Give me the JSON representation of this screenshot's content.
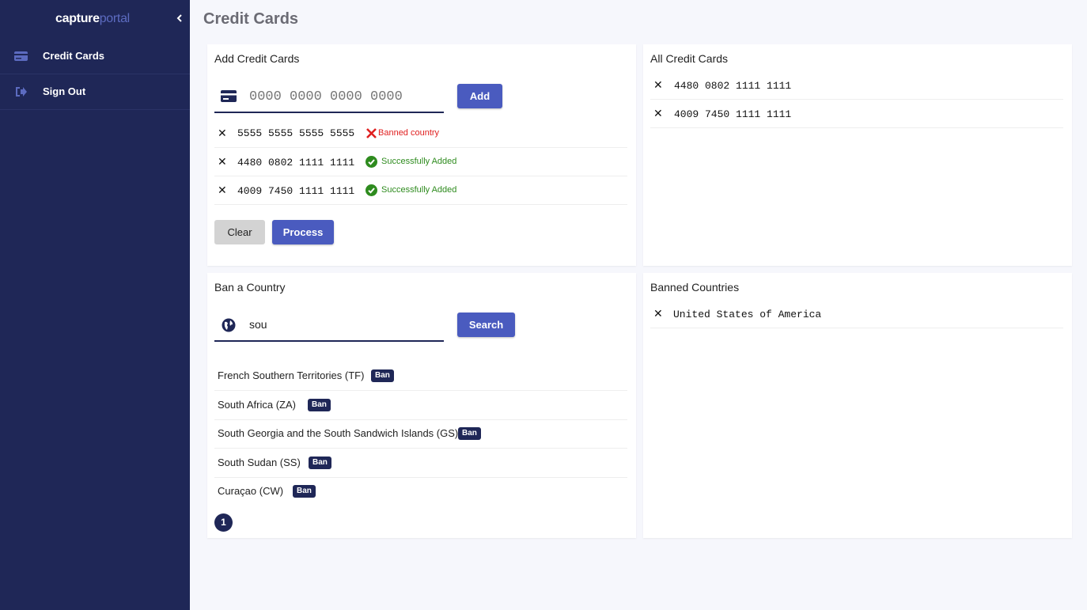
{
  "brand": {
    "part1": "capture",
    "part2": "portal"
  },
  "sidebar": {
    "items": [
      {
        "label": "Credit Cards",
        "icon": "credit-card-icon"
      },
      {
        "label": "Sign Out",
        "icon": "sign-out-icon"
      }
    ]
  },
  "page": {
    "title": "Credit Cards"
  },
  "add_cards": {
    "title": "Add Credit Cards",
    "input_placeholder": "0000 0000 0000 0000",
    "input_value": "",
    "add_label": "Add",
    "rows": [
      {
        "number": "5555 5555 5555 5555",
        "status": "Banned country",
        "ok": false
      },
      {
        "number": "4480 0802 1111 1111",
        "status": "Successfully Added",
        "ok": true
      },
      {
        "number": "4009 7450 1111 1111",
        "status": "Successfully Added",
        "ok": true
      }
    ],
    "clear_label": "Clear",
    "process_label": "Process"
  },
  "all_cards": {
    "title": "All Credit Cards",
    "rows": [
      "4480 0802 1111 1111",
      "4009 7450 1111 1111"
    ]
  },
  "ban_country": {
    "title": "Ban a Country",
    "search_value": "sou",
    "search_label": "Search",
    "results": [
      {
        "name": "French Southern Territories (TF)",
        "action": "Ban"
      },
      {
        "name": "South Africa (ZA)",
        "action": "Ban"
      },
      {
        "name": "South Georgia and the South Sandwich Islands (GS)",
        "action": "Ban"
      },
      {
        "name": "South Sudan (SS)",
        "action": "Ban"
      },
      {
        "name": "Curaçao (CW)",
        "action": "Ban"
      }
    ],
    "page": "1"
  },
  "banned": {
    "title": "Banned Countries",
    "rows": [
      "United States of America"
    ]
  },
  "colors": {
    "sidebar_bg": "#1f2757",
    "accent": "#4a5bbf",
    "error": "#e02020",
    "success": "#2e8b1e",
    "page_bg": "#f6f7fc"
  }
}
